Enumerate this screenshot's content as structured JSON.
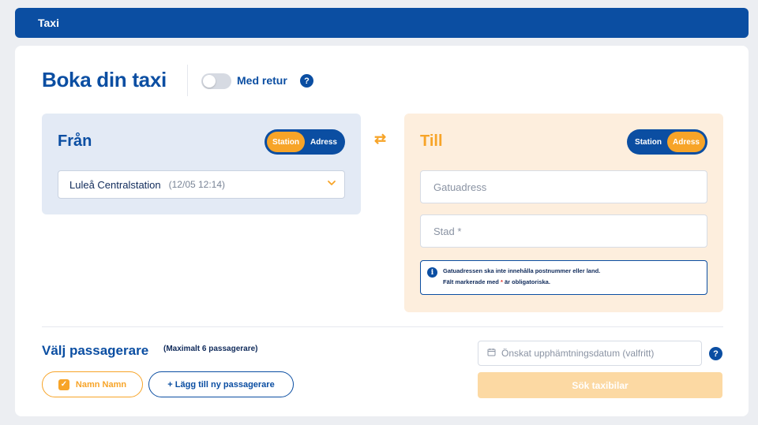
{
  "header": {
    "title": "Taxi"
  },
  "booking": {
    "title": "Boka din taxi",
    "return_toggle": {
      "label": "Med retur",
      "on": false
    },
    "help_glyph": "?"
  },
  "from": {
    "title": "Från",
    "segment": {
      "station": "Station",
      "address": "Adress",
      "selected": "Station"
    },
    "station_select": {
      "value": "Luleå Centralstation",
      "time": "(12/05 12:14)"
    }
  },
  "swap_icon": "⇄",
  "to": {
    "title": "Till",
    "segment": {
      "station": "Station",
      "address": "Adress",
      "selected": "Adress"
    },
    "street_placeholder": "Gatuadress",
    "city_placeholder": "Stad *",
    "info": {
      "line1": "Gatuadressen ska inte innehålla postnummer eller land.",
      "line2_pre": "Fält markerade med",
      "line2_star": "*",
      "line2_post": "är obligatoriska."
    }
  },
  "passengers": {
    "title": "Välj passagerare",
    "max_note": "(Maximalt 6 passagerare)",
    "items": [
      {
        "name": "Namn Namn",
        "checked": true
      }
    ],
    "add_label": "+ Lägg till ny passagerare"
  },
  "pickup_date": {
    "placeholder": "Önskat upphämtningsdatum (valfritt)"
  },
  "search_button": {
    "label": "Sök taxibilar",
    "disabled": true
  },
  "colors": {
    "brand_blue": "#0b4ea2",
    "accent_orange": "#f7a428",
    "from_bg": "#e3eaf5",
    "to_bg": "#fdeedd"
  }
}
